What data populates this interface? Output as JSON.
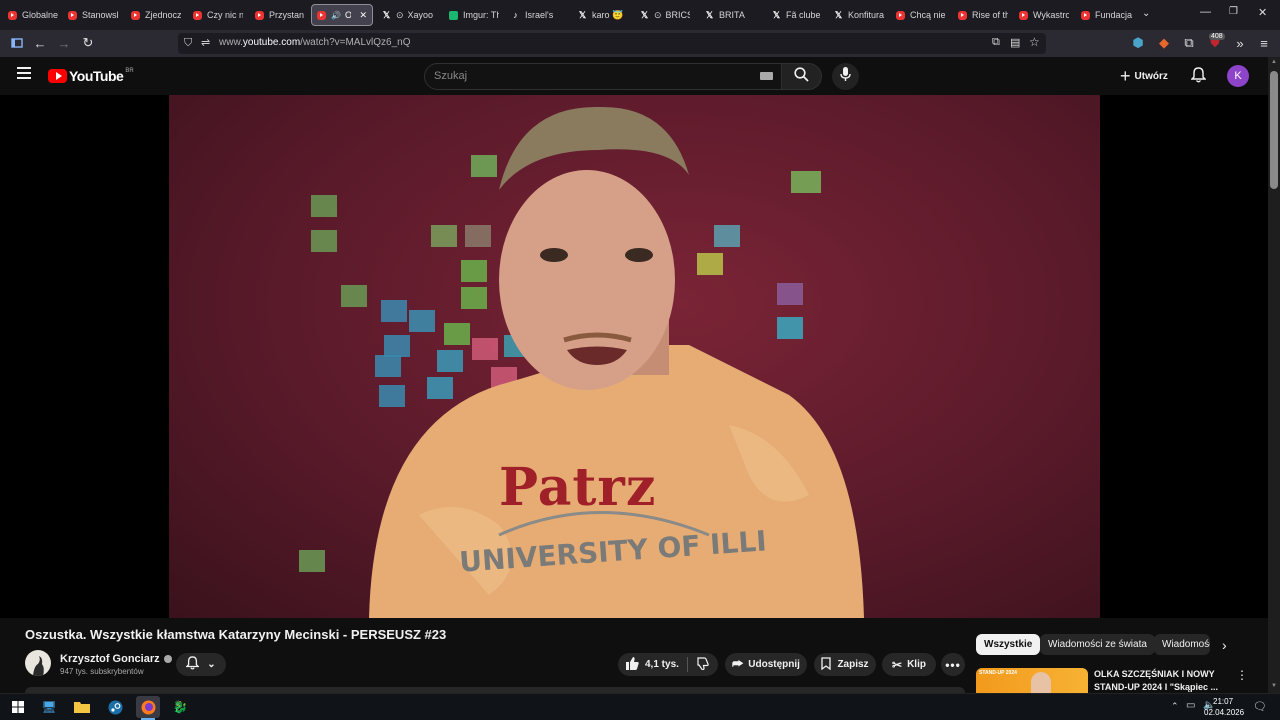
{
  "browser": {
    "tabs": [
      {
        "label": "Globalne",
        "icon": "youtube-icon"
      },
      {
        "label": "Stanowsk",
        "icon": "youtube-icon"
      },
      {
        "label": "Zjednocz",
        "icon": "youtube-icon"
      },
      {
        "label": "Czy nic n",
        "icon": "youtube-icon"
      },
      {
        "label": "Przystan",
        "icon": "youtube-icon"
      },
      {
        "label": "Os:",
        "icon": "youtube-icon"
      },
      {
        "label": "Xayoo",
        "icon": "x-icon"
      },
      {
        "label": "Imgur: Th",
        "icon": "imgur-icon"
      },
      {
        "label": "Israel's",
        "icon": "tiktok-icon"
      },
      {
        "label": "karo 😇",
        "icon": "x-icon"
      },
      {
        "label": "BRICS",
        "icon": "x-icon"
      },
      {
        "label": "BRITA",
        "icon": "x-icon"
      },
      {
        "label": "Fã clube",
        "icon": "x-icon"
      },
      {
        "label": "Konfitura",
        "icon": "x-icon"
      },
      {
        "label": "Chcą niel",
        "icon": "youtube-icon"
      },
      {
        "label": "Rise of th",
        "icon": "youtube-icon"
      },
      {
        "label": "Wykastro",
        "icon": "youtube-icon"
      },
      {
        "label": "Fundacja",
        "icon": "youtube-icon"
      }
    ],
    "url_prefix": "www.",
    "url_host": "youtube.com",
    "url_path": "/watch?v=MALvlQz6_nQ",
    "extension_badge": "408"
  },
  "youtube": {
    "logo_text": "YouTube",
    "country_code": "BR",
    "search_placeholder": "Szukaj",
    "create_label": "Utwórz",
    "avatar_letter": "K",
    "avatar_color": "#8e44c9"
  },
  "video": {
    "shirt_text": "Patrz",
    "shirt_subtext": "UNIVERSITY OF ILLI",
    "title": "Oszustka. Wszystkie kłamstwa Katarzyny Mecinski - PERSEUSZ #23",
    "channel_name": "Krzysztof Gonciarz",
    "subscribers": "947 tys. subskrybentów",
    "likes": "4,1 tys.",
    "share_label": "Udostępnij",
    "save_label": "Zapisz",
    "clip_label": "Klip"
  },
  "chips": [
    "Wszystkie",
    "Wiadomości ze świata",
    "Wiadomości"
  ],
  "recommendation": {
    "title": "OLKA SZCZĘŚNIAK I NOWY STAND-UP 2024 I \"Skąpiec ...",
    "thumb_label": "STAND-UP 2024"
  },
  "taskbar": {
    "time": "21:07",
    "date": "02.04.2026"
  }
}
